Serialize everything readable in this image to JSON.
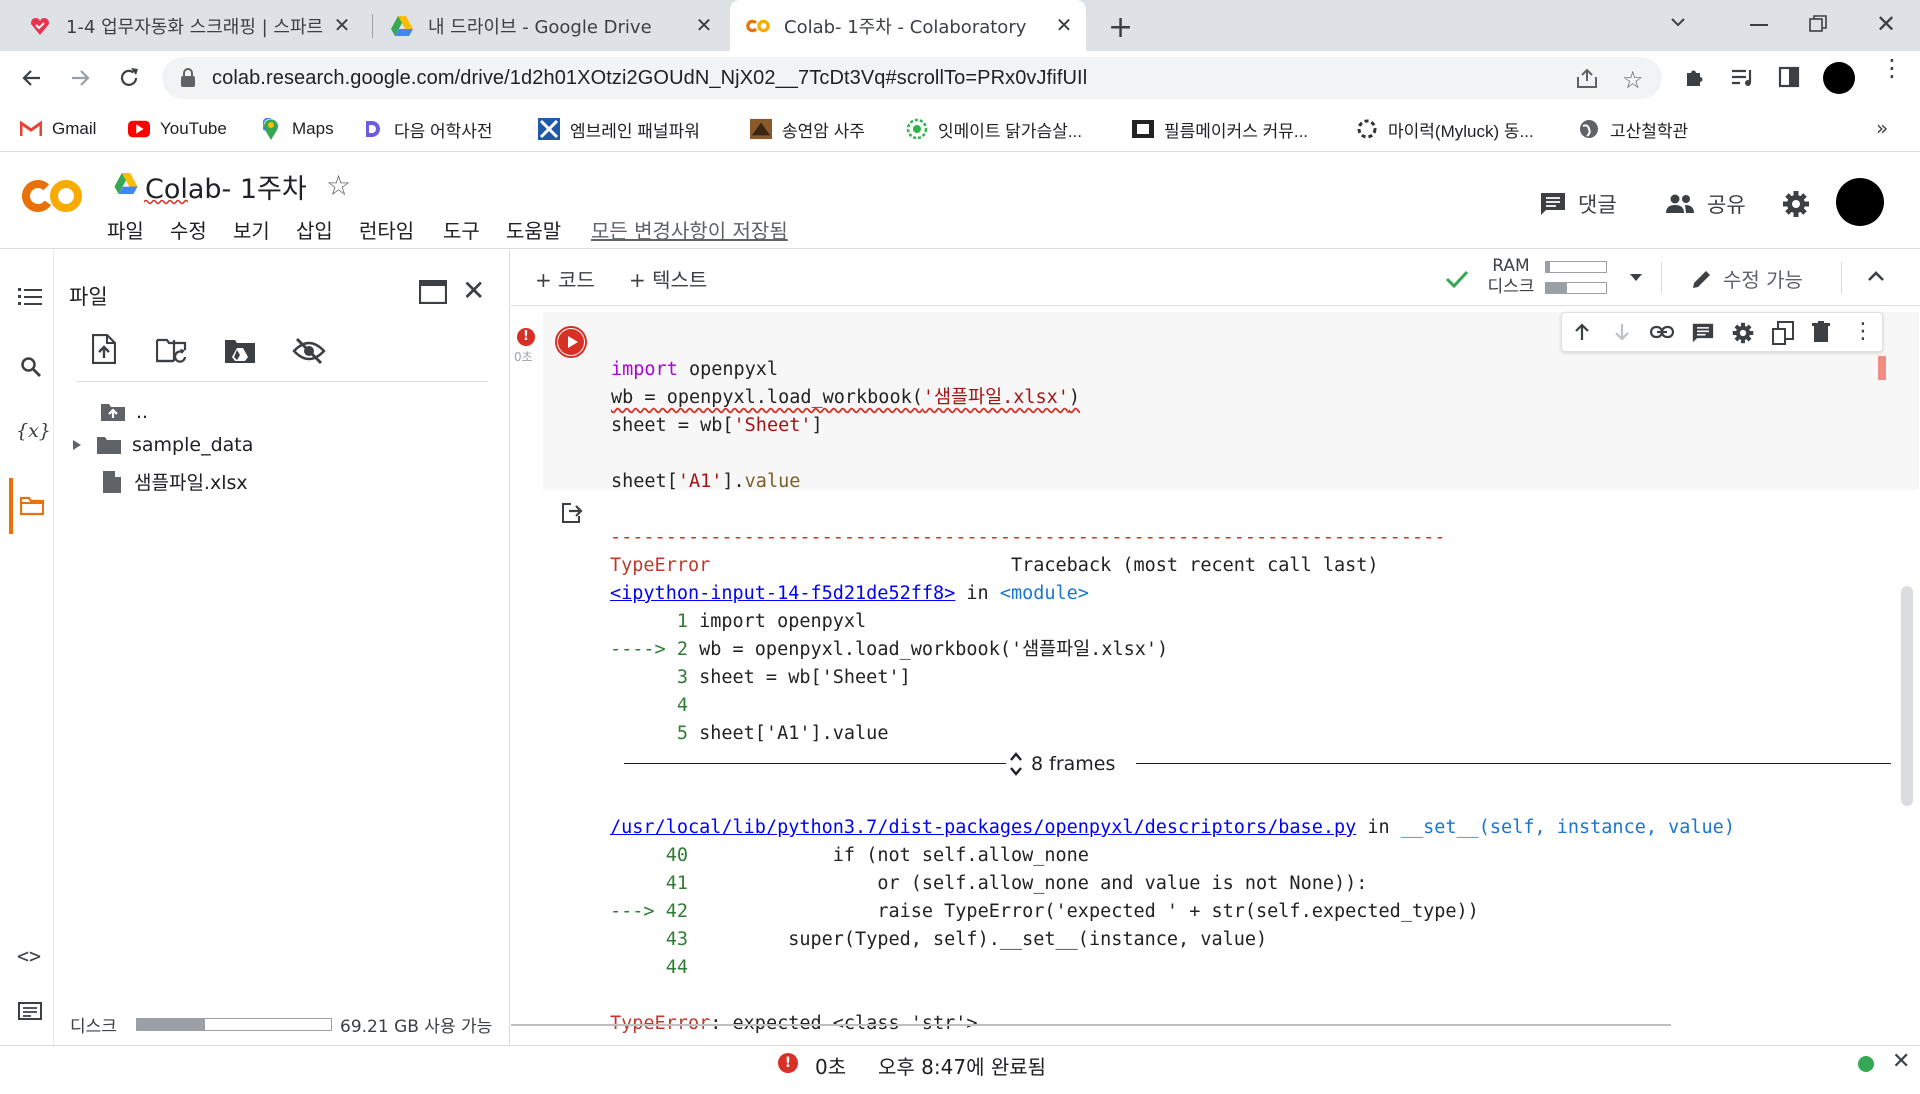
{
  "browser": {
    "tabs": [
      {
        "title": "1-4 업무자동화 스크래핑 | 스파르",
        "icon": "sparta-icon"
      },
      {
        "title": "내 드라이브 - Google Drive",
        "icon": "google-drive-icon"
      },
      {
        "title": "Colab- 1주차 - Colaboratory",
        "icon": "colab-icon",
        "active": true
      }
    ],
    "new_tab": "+",
    "url": "colab.research.google.com/drive/1d2h01XOtzi2GOUdN_NjX02__7TcDt3Vq#scrollTo=PRx0vJfifUIl",
    "bookmarks": [
      {
        "label": "Gmail",
        "icon": "gmail-icon"
      },
      {
        "label": "YouTube",
        "icon": "youtube-icon"
      },
      {
        "label": "Maps",
        "icon": "maps-icon"
      },
      {
        "label": "다음 어학사전",
        "icon": "daum-icon"
      },
      {
        "label": "엠브레인 패널파워",
        "icon": "embrain-icon"
      },
      {
        "label": "송연암 사주",
        "icon": "saju-icon"
      },
      {
        "label": "잇메이트 닭가슴살...",
        "icon": "eatmate-icon"
      },
      {
        "label": "필름메이커스 커뮤...",
        "icon": "filmmakers-icon"
      },
      {
        "label": "마이럭(Myluck) 동...",
        "icon": "myluck-icon"
      },
      {
        "label": "고산철학관",
        "icon": "globe-icon"
      }
    ],
    "bookmarks_more": "»"
  },
  "colab": {
    "logo": "CO",
    "title": "Colab- 1주차",
    "menu": [
      "파일",
      "수정",
      "보기",
      "삽입",
      "런타임",
      "도구",
      "도움말"
    ],
    "saved_status": "모든 변경사항이 저장됨",
    "comment_label": "댓글",
    "share_label": "공유",
    "toolbar": {
      "add_code": "+ 코드",
      "add_text": "+ 텍스트",
      "ram_label": "RAM",
      "disk_label": "디스크",
      "edit_mode": "수정 가능"
    }
  },
  "files_panel": {
    "title": "파일",
    "items": [
      {
        "name": "..",
        "type": "parent-folder"
      },
      {
        "name": "sample_data",
        "type": "folder"
      },
      {
        "name": "샘플파일.xlsx",
        "type": "file"
      }
    ],
    "disk_label": "디스크",
    "disk_usage": "69.21 GB 사용 가능",
    "disk_fraction": 0.35
  },
  "cell": {
    "exec_time": "0초",
    "code_lines": [
      "import openpyxl",
      "wb = openpyxl.load_workbook('샘플파일.xlsx')",
      "sheet = wb['Sheet']",
      "",
      "sheet['A1'].value"
    ],
    "output": {
      "dashes": "---------------------------------------------------------------------------",
      "error_name": "TypeError",
      "traceback_header": "Traceback (most recent call last)",
      "input_link": "<ipython-input-14-f5d21de52ff8>",
      "in_text": "in",
      "module_text": "<module>",
      "tb1_lines": [
        {
          "prefix": "      ",
          "num": "1",
          "code": "import openpyxl"
        },
        {
          "prefix": "----> ",
          "num": "2",
          "code": "wb = openpyxl.load_workbook('샘플파일.xlsx')"
        },
        {
          "prefix": "      ",
          "num": "3",
          "code": "sheet = wb['Sheet']"
        },
        {
          "prefix": "      ",
          "num": "4",
          "code": ""
        },
        {
          "prefix": "      ",
          "num": "5",
          "code": "sheet['A1'].value"
        }
      ],
      "frames_label": "8 frames",
      "file_link": "/usr/local/lib/python3.7/dist-packages/openpyxl/descriptors/base.py",
      "func_sig": "__set__(self, instance, value)",
      "tb2_lines": [
        {
          "prefix": "     ",
          "num": "40",
          "code": "            if (not self.allow_none"
        },
        {
          "prefix": "     ",
          "num": "41",
          "code": "                or (self.allow_none and value is not None)):"
        },
        {
          "prefix": "---> ",
          "num": "42",
          "code": "                raise TypeError('expected ' + str(self.expected_type))"
        },
        {
          "prefix": "     ",
          "num": "43",
          "code": "        super(Typed, self).__set__(instance, value)"
        },
        {
          "prefix": "     ",
          "num": "44",
          "code": ""
        }
      ],
      "final_error_name": "TypeError",
      "final_error_msg": ": expected <class 'str'>"
    }
  },
  "status": {
    "exec_time": "0초",
    "completed": "오후 8:47에 완료됨"
  }
}
